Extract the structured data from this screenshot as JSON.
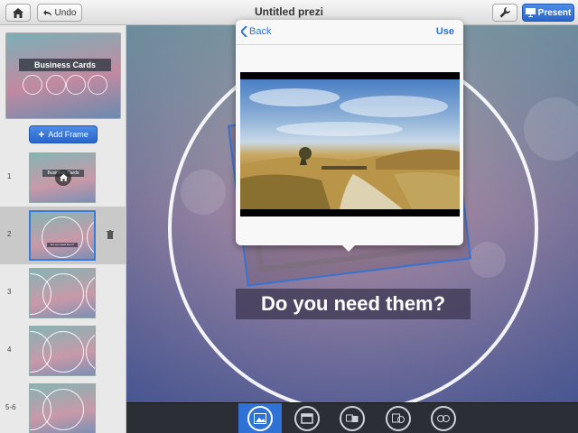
{
  "topbar": {
    "undo_label": "Undo",
    "title": "Untitled prezi",
    "present_label": "Present"
  },
  "sidebar": {
    "overview_title": "Business Cards",
    "add_frame_label": "Add Frame",
    "frames": [
      {
        "number": "1",
        "thumb_text": "Business Cards"
      },
      {
        "number": "2",
        "thumb_text": "Do you need them?"
      },
      {
        "number": "3"
      },
      {
        "number": "4"
      },
      {
        "number": "5-6"
      }
    ]
  },
  "canvas": {
    "caption": "Do you need them?"
  },
  "popover": {
    "back_label": "Back",
    "use_label": "Use"
  },
  "colors": {
    "accent": "#2a74d8",
    "toolbar_bg": "#2b2e35"
  },
  "bottom_tools": [
    "image-tool-icon",
    "frame-tool-icon",
    "layout-tool-icon",
    "media-tool-icon",
    "circles-tool-icon"
  ]
}
